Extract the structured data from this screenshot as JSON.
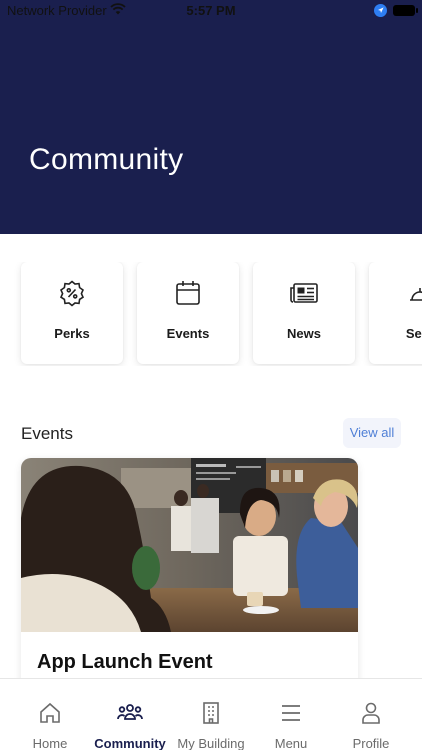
{
  "status_bar": {
    "carrier": "Network Provider",
    "time": "5:57 PM"
  },
  "hero": {
    "title": "Community",
    "background": "#1a1f4e"
  },
  "quick_links": [
    {
      "label": "Perks",
      "icon": "percent-badge-icon"
    },
    {
      "label": "Events",
      "icon": "calendar-icon"
    },
    {
      "label": "News",
      "icon": "newspaper-icon"
    },
    {
      "label": "Serv",
      "icon": "bell-icon"
    }
  ],
  "events_section": {
    "heading": "Events",
    "view_all_label": "View all",
    "accent": "#4f7fd6"
  },
  "event_card": {
    "title": "App Launch Event"
  },
  "tab_bar": {
    "active": "Community",
    "tabs": [
      {
        "label": "Home",
        "icon": "home-icon"
      },
      {
        "label": "Community",
        "icon": "people-icon"
      },
      {
        "label": "My Building",
        "icon": "building-icon"
      },
      {
        "label": "Menu",
        "icon": "menu-icon"
      },
      {
        "label": "Profile",
        "icon": "person-icon"
      }
    ]
  }
}
